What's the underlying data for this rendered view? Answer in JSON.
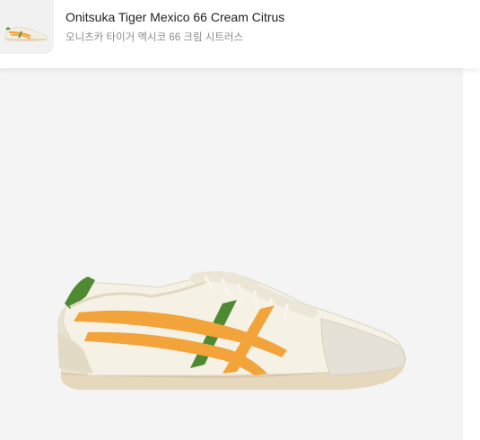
{
  "product": {
    "name": "Onitsuka Tiger Mexico 66 Cream Citrus",
    "name_ko": "오니츠카 타이거 멕시코 66 크림 시트러스"
  },
  "icons": {
    "thumbnail": "shoe-thumbnail-image",
    "main": "shoe-product-image"
  },
  "colors": {
    "background": "#f4f4f4",
    "shoe_cream": "#f3efe2",
    "stripe_orange": "#f2a33a",
    "stripe_green": "#4f8a33",
    "sole": "#e6d8bd"
  }
}
